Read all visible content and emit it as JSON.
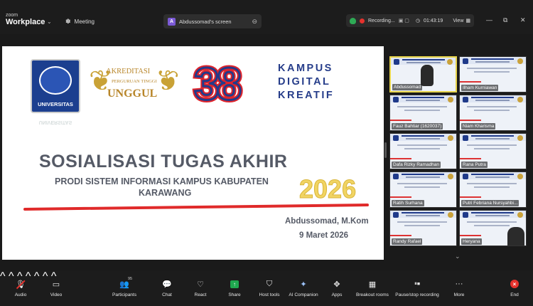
{
  "app": {
    "brand_small": "zoom",
    "brand_big": "Workplace"
  },
  "header": {
    "meeting_label": "Meeting",
    "screen_badge": "A",
    "screen_title": "Abdussomad's screen",
    "recording_label": "Recording...",
    "timer": "01:43:19",
    "view_label": "View"
  },
  "slide": {
    "university_label": "UNIVERSITAS",
    "university_reflection": "UNIVERSITAS",
    "accreditation_line1": "AKREDITASI",
    "accreditation_line2": "PERGURUAN TINGGI",
    "accreditation_line3": "UNGGUL",
    "big_number": "38",
    "campus_line1": "KAMPUS",
    "campus_line2": "DIGITAL",
    "campus_line3": "KREATIF",
    "title": "SOSIALISASI TUGAS AKHIR",
    "subtitle_line1": "PRODI SISTEM INFORMASI KAMPUS KABUPATEN",
    "subtitle_line2": "KARAWANG",
    "year": "2026",
    "author": "Abdussomad, M.Kom",
    "date": "9 Maret 2026"
  },
  "gallery": {
    "tiles": [
      {
        "name": "Abdussomad"
      },
      {
        "name": "Ilham Kurniawan"
      },
      {
        "name": "Fauz Bahtiar (1620037)"
      },
      {
        "name": "Niam Kharisma"
      },
      {
        "name": "Dafa Rizky Ramadhan"
      },
      {
        "name": "Rana Putra"
      },
      {
        "name": "Ratih Surhana"
      },
      {
        "name": "Putri Febriana Nursyahbi..."
      },
      {
        "name": "Randy Rafael"
      },
      {
        "name": "Heryana"
      }
    ]
  },
  "toolbar": {
    "audio": "Audio",
    "video": "Video",
    "participants": "Participants",
    "participants_count": "95",
    "chat": "Chat",
    "react": "React",
    "share": "Share",
    "host_tools": "Host tools",
    "ai_companion": "AI Companion",
    "apps": "Apps",
    "breakout_rooms": "Breakout rooms",
    "record": "Pause/stop recording",
    "more": "More",
    "end": "End"
  },
  "colors": {
    "accent_green": "#1fa84f",
    "end_red": "#e5322d",
    "speaker_border": "#e7d44a"
  }
}
